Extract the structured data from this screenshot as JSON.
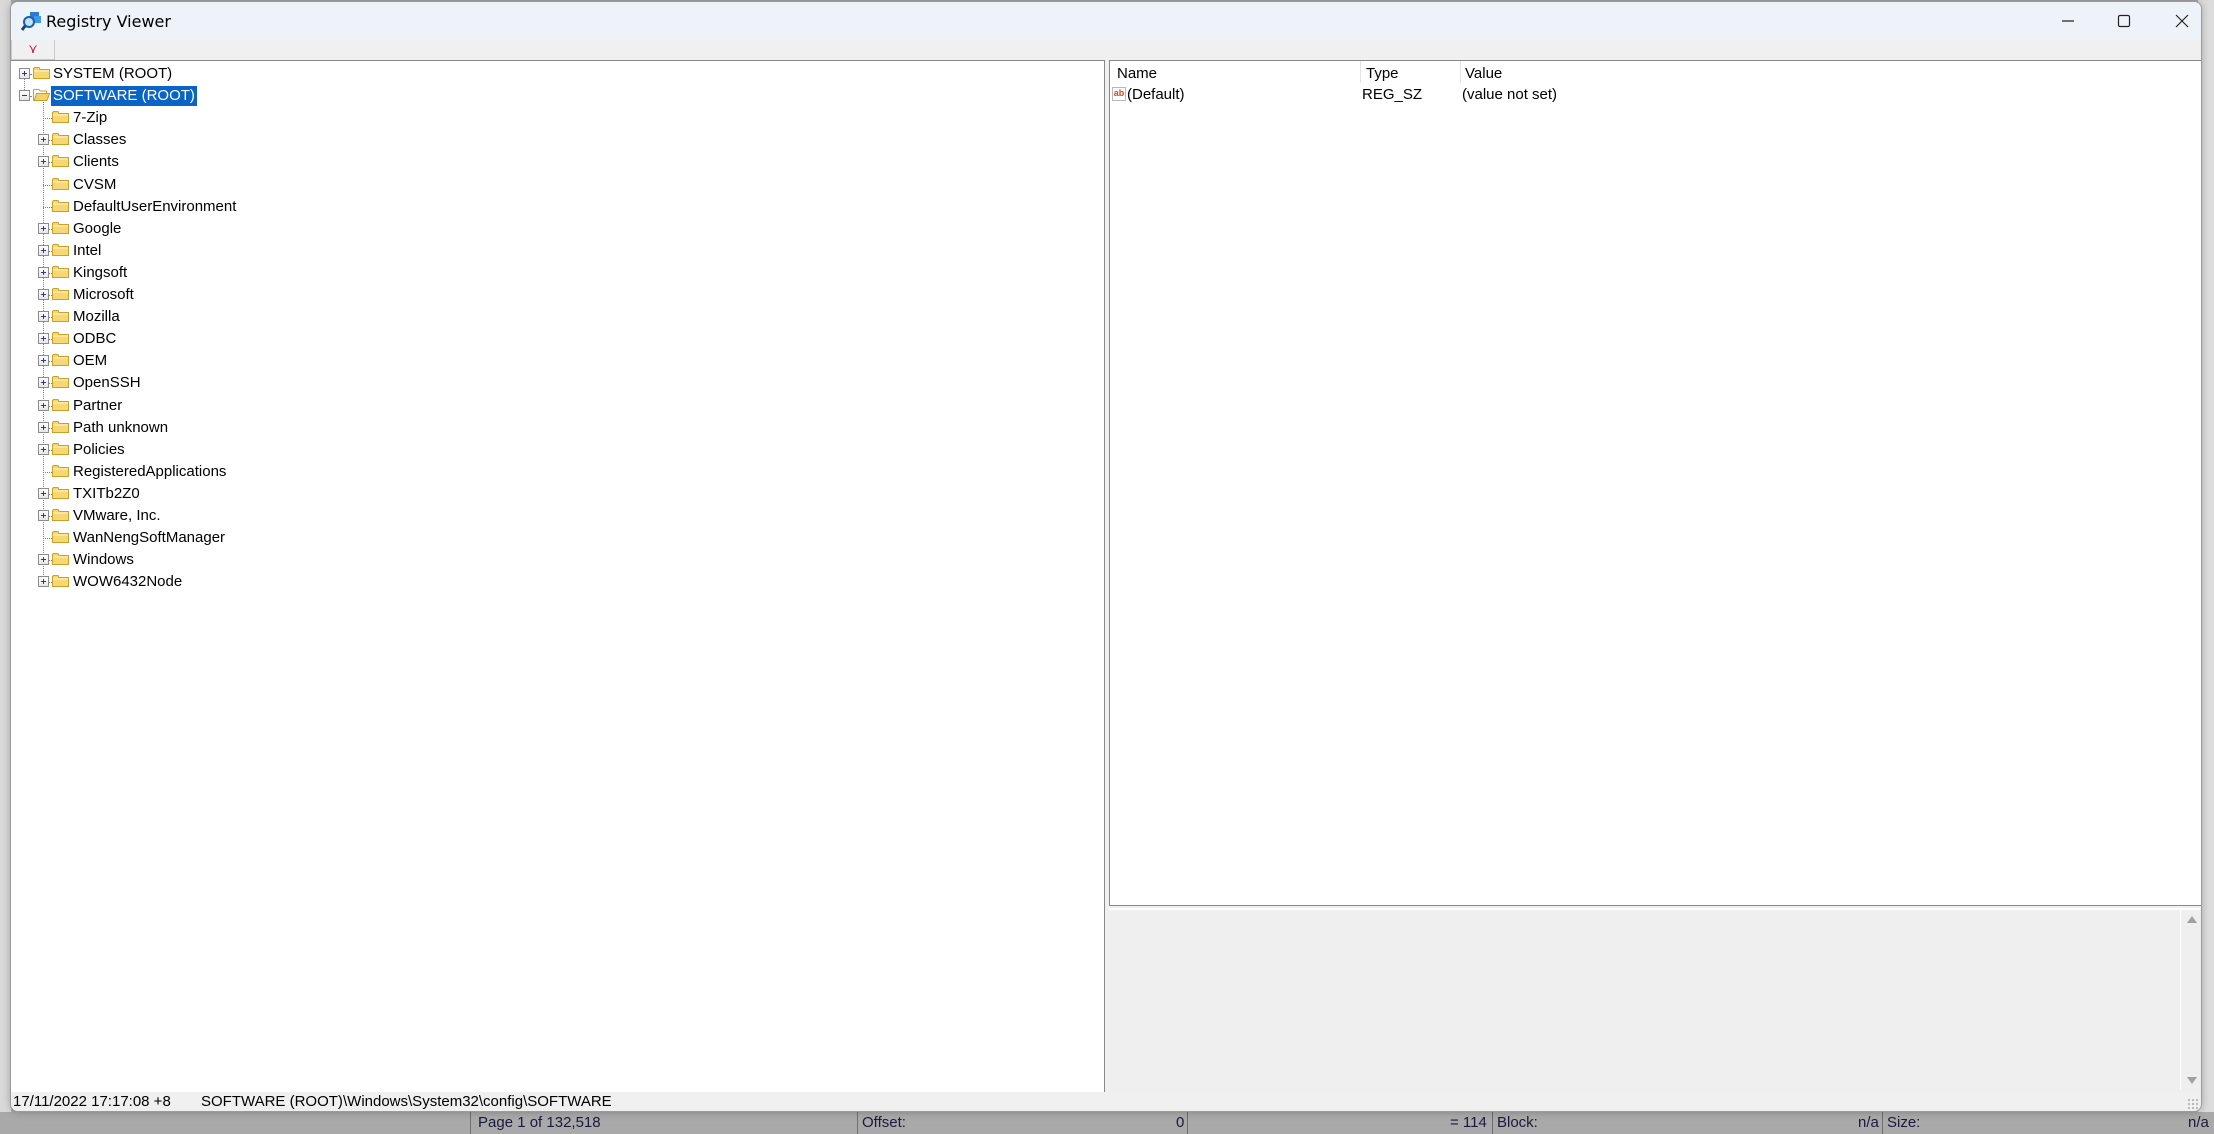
{
  "window": {
    "title": "Registry Viewer",
    "toolbar_button": "⋎"
  },
  "tree": {
    "roots": [
      {
        "label": "SYSTEM (ROOT)",
        "expander": "plus",
        "selected": false
      },
      {
        "label": "SOFTWARE (ROOT)",
        "expander": "minus",
        "selected": true
      }
    ],
    "children": [
      {
        "label": "7-Zip",
        "expander": "none"
      },
      {
        "label": "Classes",
        "expander": "plus"
      },
      {
        "label": "Clients",
        "expander": "plus"
      },
      {
        "label": "CVSM",
        "expander": "none"
      },
      {
        "label": "DefaultUserEnvironment",
        "expander": "none"
      },
      {
        "label": "Google",
        "expander": "plus"
      },
      {
        "label": "Intel",
        "expander": "plus"
      },
      {
        "label": "Kingsoft",
        "expander": "plus"
      },
      {
        "label": "Microsoft",
        "expander": "plus"
      },
      {
        "label": "Mozilla",
        "expander": "plus"
      },
      {
        "label": "ODBC",
        "expander": "plus"
      },
      {
        "label": "OEM",
        "expander": "plus"
      },
      {
        "label": "OpenSSH",
        "expander": "plus"
      },
      {
        "label": "Partner",
        "expander": "plus"
      },
      {
        "label": "Path unknown",
        "expander": "plus"
      },
      {
        "label": "Policies",
        "expander": "plus"
      },
      {
        "label": "RegisteredApplications",
        "expander": "none"
      },
      {
        "label": "TXITb2Z0",
        "expander": "plus"
      },
      {
        "label": "VMware, Inc.",
        "expander": "plus"
      },
      {
        "label": "WanNengSoftManager",
        "expander": "none"
      },
      {
        "label": "Windows",
        "expander": "plus"
      },
      {
        "label": "WOW6432Node",
        "expander": "plus"
      }
    ]
  },
  "values_list": {
    "columns": [
      "Name",
      "Type",
      "Value"
    ],
    "rows": [
      {
        "icon": "string-value-icon",
        "icon_text": "ab",
        "name": "(Default)",
        "type": "REG_SZ",
        "value": "(value not set)"
      }
    ]
  },
  "statusbar": {
    "timestamp": "17/11/2022  17:17:08  +8",
    "hive": "SOFTWARE (ROOT)",
    "path": "\\Windows\\System32\\config\\SOFTWARE"
  },
  "background_app": {
    "page": "Page 1 of 132,518",
    "offset_label": "Offset:",
    "offset_value": "0",
    "eq_value": "= 114",
    "block_label": "Block:",
    "block_value": "n/a",
    "size_label": "Size:",
    "size_value": "n/a"
  },
  "colors": {
    "selection": "#0a64c8",
    "titlebar": "#eef3fa",
    "value_icon": "#d4461f"
  }
}
